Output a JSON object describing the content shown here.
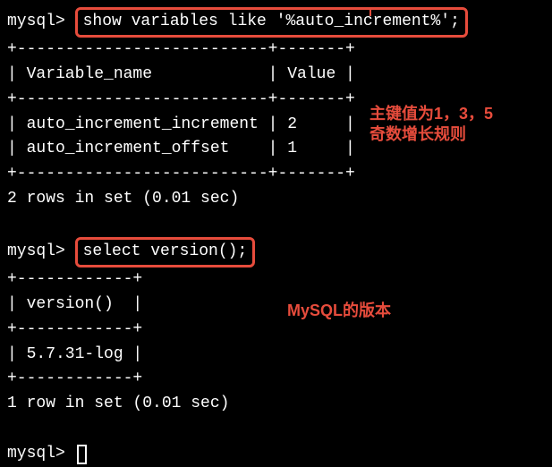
{
  "prompt": "mysql> ",
  "query1": "show variables like '%auto_increment%';",
  "table1": {
    "border_top": "+--------------------------+-------+",
    "header": "| Variable_name            | Value |",
    "border_mid": "+--------------------------+-------+",
    "row1": "| auto_increment_increment | 2     |",
    "row2": "| auto_increment_offset    | 1     |",
    "border_bot": "+--------------------------+-------+"
  },
  "result1": "2 rows in set (0.01 sec)",
  "query2": "select version();",
  "table2": {
    "border_top": "+------------+",
    "header": "| version()  |",
    "border_mid": "+------------+",
    "row1": "| 5.7.31-log |",
    "border_bot": "+------------+"
  },
  "result2": "1 row in set (0.01 sec)",
  "annotation1": "主键值为1，3，5\n奇数增长规则",
  "annotation2": "MySQL的版本",
  "chart_data": {
    "type": "table",
    "tables": [
      {
        "title": "show variables like '%auto_increment%'",
        "columns": [
          "Variable_name",
          "Value"
        ],
        "rows": [
          [
            "auto_increment_increment",
            "2"
          ],
          [
            "auto_increment_offset",
            "1"
          ]
        ]
      },
      {
        "title": "select version()",
        "columns": [
          "version()"
        ],
        "rows": [
          [
            "5.7.31-log"
          ]
        ]
      }
    ]
  }
}
